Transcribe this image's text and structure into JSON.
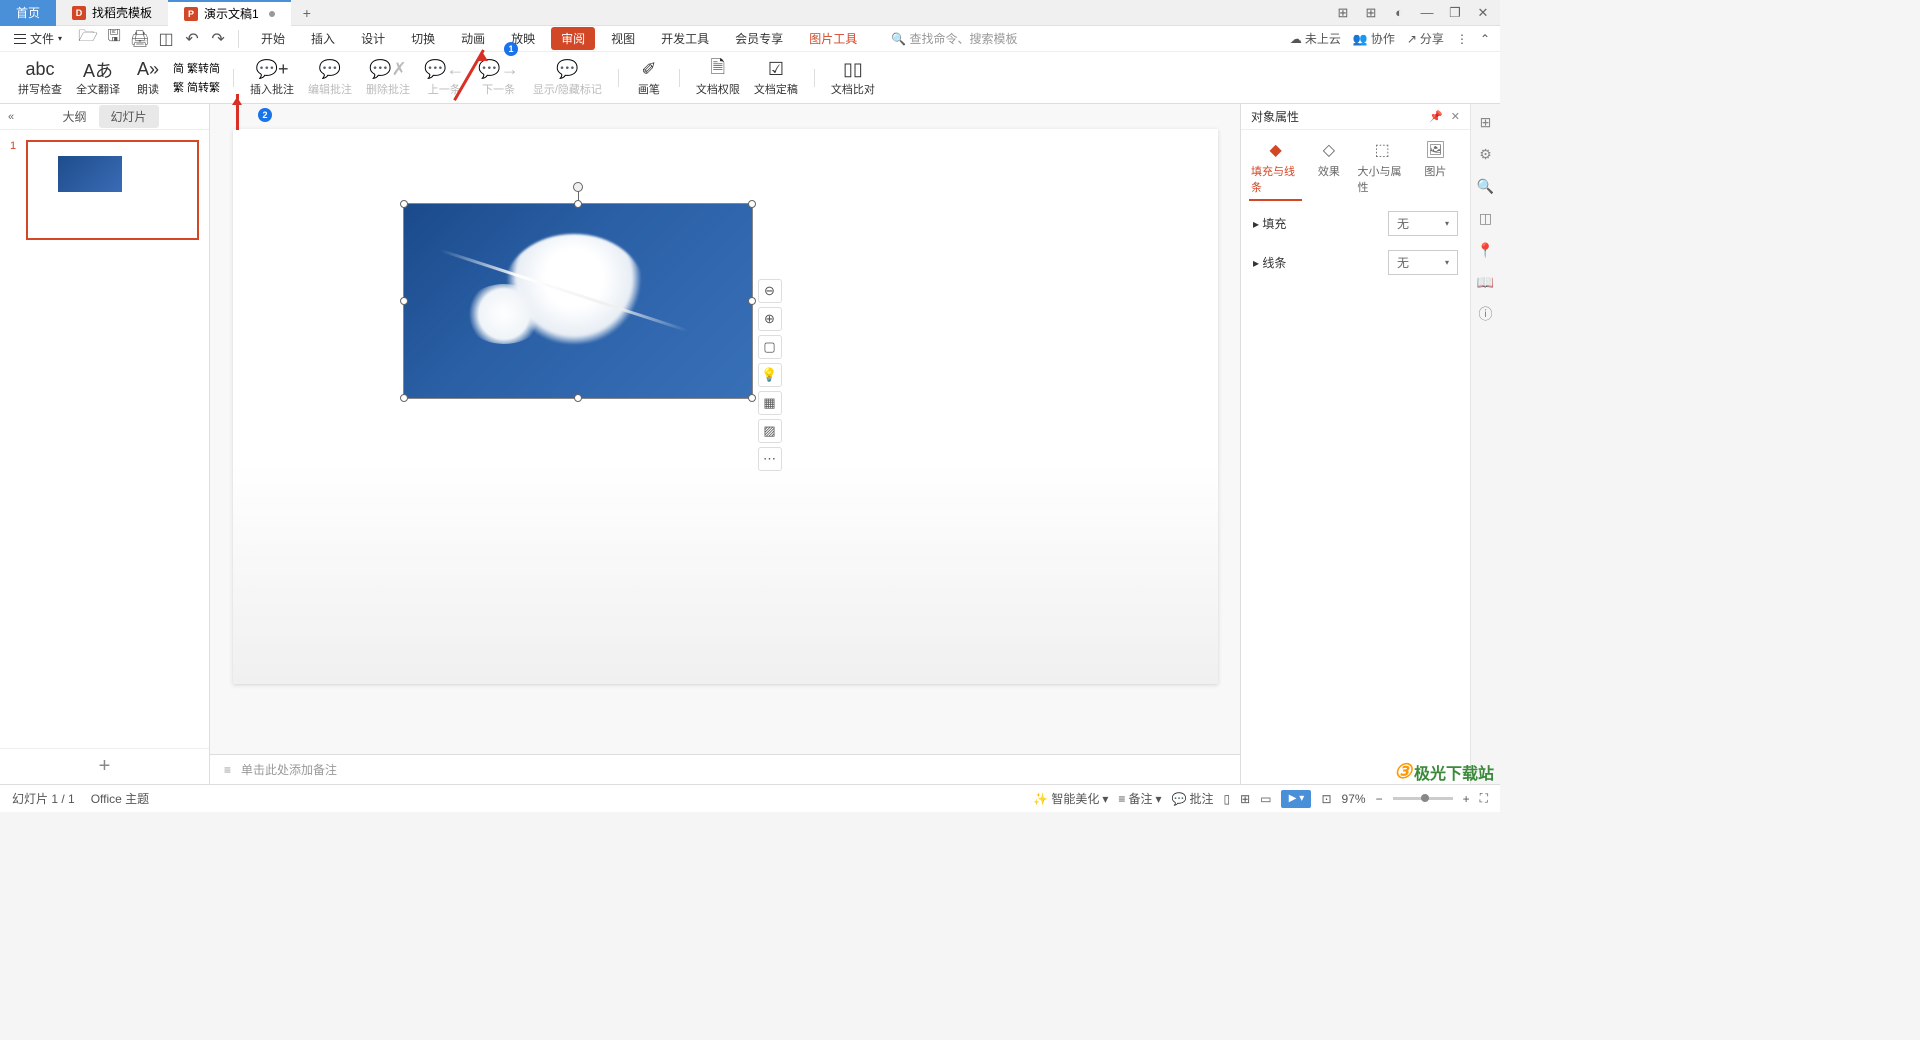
{
  "titlebar": {
    "tabs": [
      {
        "label": "首页"
      },
      {
        "label": "找稻壳模板"
      },
      {
        "label": "演示文稿1"
      }
    ],
    "window_controls": {
      "min": "—",
      "restore": "❐",
      "close": "✕"
    }
  },
  "menubar": {
    "file": "文件",
    "tabs": [
      "开始",
      "插入",
      "设计",
      "切换",
      "动画",
      "放映",
      "审阅",
      "视图",
      "开发工具",
      "会员专享",
      "图片工具"
    ],
    "active_tab": "审阅",
    "highlight_tab": "图片工具",
    "search_placeholder": "查找命令、搜索模板",
    "right": {
      "cloud": "未上云",
      "collab": "协作",
      "share": "分享"
    }
  },
  "ribbon": {
    "items": [
      {
        "icon": "abc✓",
        "label": "拼写检查"
      },
      {
        "icon": "A⇄",
        "label": "全文翻译"
      },
      {
        "icon": "A»",
        "label": "朗读"
      },
      {
        "icon_top": "繁转简",
        "icon_bottom": "简转繁",
        "label_top": "简",
        "label_bottom": "繁"
      },
      {
        "icon": "✎□",
        "label": "插入批注"
      },
      {
        "icon": "✎□",
        "label": "编辑批注",
        "disabled": true
      },
      {
        "icon": "✗□",
        "label": "删除批注",
        "disabled": true
      },
      {
        "icon": "←",
        "label": "上一条",
        "disabled": true
      },
      {
        "icon": "→",
        "label": "下一条",
        "disabled": true
      },
      {
        "icon": "□",
        "label": "显示/隐藏标记",
        "disabled": true
      },
      {
        "icon": "✐",
        "label": "画笔"
      },
      {
        "icon": "🔒",
        "label": "文档权限"
      },
      {
        "icon": "☑",
        "label": "文档定稿"
      },
      {
        "icon": "▣▣",
        "label": "文档比对"
      }
    ]
  },
  "left_panel": {
    "view_outline": "大纲",
    "view_slides": "幻灯片",
    "slides": [
      {
        "num": "1"
      }
    ]
  },
  "right_panel": {
    "title": "对象属性",
    "tabs": [
      {
        "icon": "◆",
        "label": "填充与线条"
      },
      {
        "icon": "✦",
        "label": "效果"
      },
      {
        "icon": "⬚",
        "label": "大小与属性"
      },
      {
        "icon": "🖼",
        "label": "图片"
      }
    ],
    "rows": [
      {
        "label": "填充",
        "value": "无"
      },
      {
        "label": "线条",
        "value": "无"
      }
    ]
  },
  "annotations": {
    "num1": "1",
    "num2": "2"
  },
  "float_tools": [
    "⊖",
    "⊕",
    "▢",
    "💡",
    "▦",
    "▨",
    "⋯"
  ],
  "notes": {
    "placeholder": "单击此处添加备注"
  },
  "statusbar": {
    "left": {
      "slide_indicator": "幻灯片 1 / 1",
      "theme": "Office 主题"
    },
    "right": {
      "beautify": "智能美化",
      "notes": "备注",
      "comments": "批注",
      "zoom": "97%"
    }
  },
  "watermark": {
    "text": "极光下载站"
  }
}
